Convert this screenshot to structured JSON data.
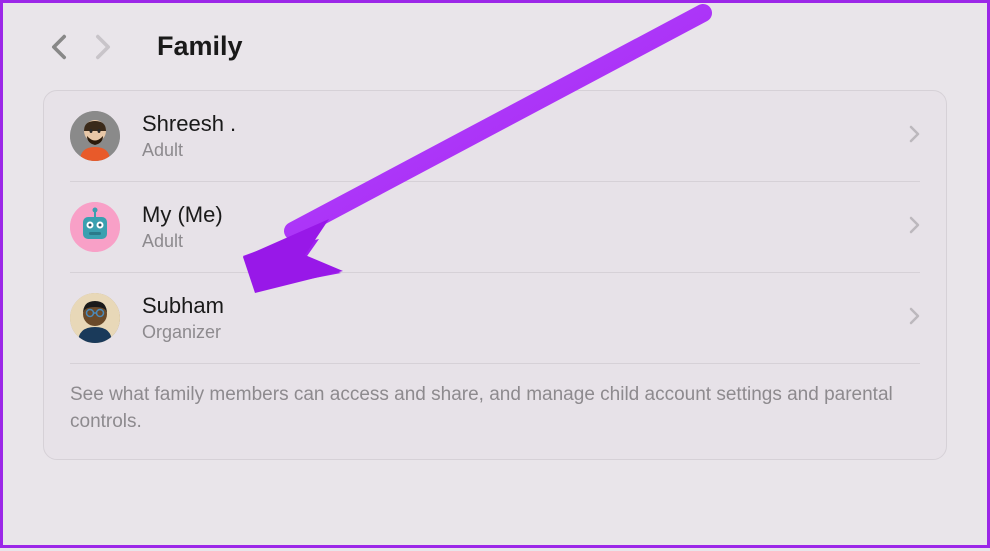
{
  "header": {
    "title": "Family"
  },
  "members": [
    {
      "name": "Shreesh .",
      "role": "Adult"
    },
    {
      "name": "My (Me)",
      "role": "Adult"
    },
    {
      "name": "Subham",
      "role": "Organizer"
    }
  ],
  "footer": "See what family members can access and share, and manage child account settings and parental controls."
}
